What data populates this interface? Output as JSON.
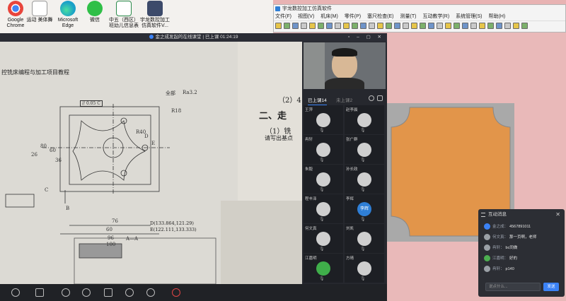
{
  "desktop_icons": [
    {
      "label": "Google\nChrome",
      "icon": "chrome-icon",
      "color": "#e8453c"
    },
    {
      "label": "运动 美体舞",
      "icon": "word-doc-icon",
      "color": "#2b5eb4"
    },
    {
      "label": "Microsoft\nEdge",
      "icon": "edge-icon",
      "color": "#1aa0c8"
    },
    {
      "label": "微信",
      "icon": "wechat-icon",
      "color": "#2fbf47"
    },
    {
      "label": "中五（西区）\n班幼儿信息表",
      "icon": "excel-doc-icon",
      "color": "#2a8a4a"
    },
    {
      "label": "宇龙数控加工\n仿真软件V...",
      "icon": "app-shortcut-icon",
      "color": "#3c4a6a"
    }
  ],
  "simulator": {
    "title": "宇龙数控加工仿真软件",
    "menu": [
      "文件(F)",
      "视图(V)",
      "机床(M)",
      "零件(P)",
      "塞尺检查(E)",
      "测量(T)",
      "互动教学(R)",
      "系统管理(S)",
      "帮助(H)"
    ]
  },
  "meeting": {
    "title": "金之成发起的在线课堂 | 已上课 01:24:19",
    "tabs": {
      "joined": "已上课14",
      "not_joined": "未上课2"
    },
    "participants": [
      "王萍",
      "赵李晨",
      "冉轩",
      "张广群",
      "朱毅",
      "孙长政",
      "程丰泽",
      "李辉",
      "何文真",
      "刘凯",
      "江嘉明",
      "方晴"
    ],
    "avatar_text": "李辉"
  },
  "book": {
    "title": "控铣床编程与加工项目教程",
    "right_text_1": "（2）4",
    "right_text_2": "二、走",
    "right_text_3": "（1）铣",
    "right_text_4": "请写出基点",
    "tolerance": "// 0.05 C",
    "roughness_all": "全部",
    "roughness": "Ra3.2",
    "dims": [
      "R18",
      "R40",
      "60",
      "76",
      "96",
      "100",
      "80",
      "60",
      "26",
      "36",
      "B",
      "C",
      "D",
      "E"
    ],
    "coord_d": "D(133.864,121.29)",
    "coord_e": "E(122.111,133.333)",
    "section": "A—A"
  },
  "messages": {
    "title": "互动消息",
    "items": [
      {
        "who": "金之成：",
        "text": "4567891011",
        "color": "#3b82f6"
      },
      {
        "who": "何文真：",
        "text": "那一页啊，老师",
        "color": "#9aa0a6"
      },
      {
        "who": "冉轩：",
        "text": "bc同做",
        "color": "#9aa0a6"
      },
      {
        "who": "江嘉明：",
        "text": "好的",
        "color": "#4caf50"
      },
      {
        "who": "冉轩：",
        "text": "p140",
        "color": "#9aa0a6"
      }
    ],
    "placeholder": "说点什么...",
    "send": "发送"
  },
  "colors": {
    "workpiece": "#e2954a",
    "viewport_bg": "#e9b9b9",
    "accent": "#3b82f6"
  }
}
